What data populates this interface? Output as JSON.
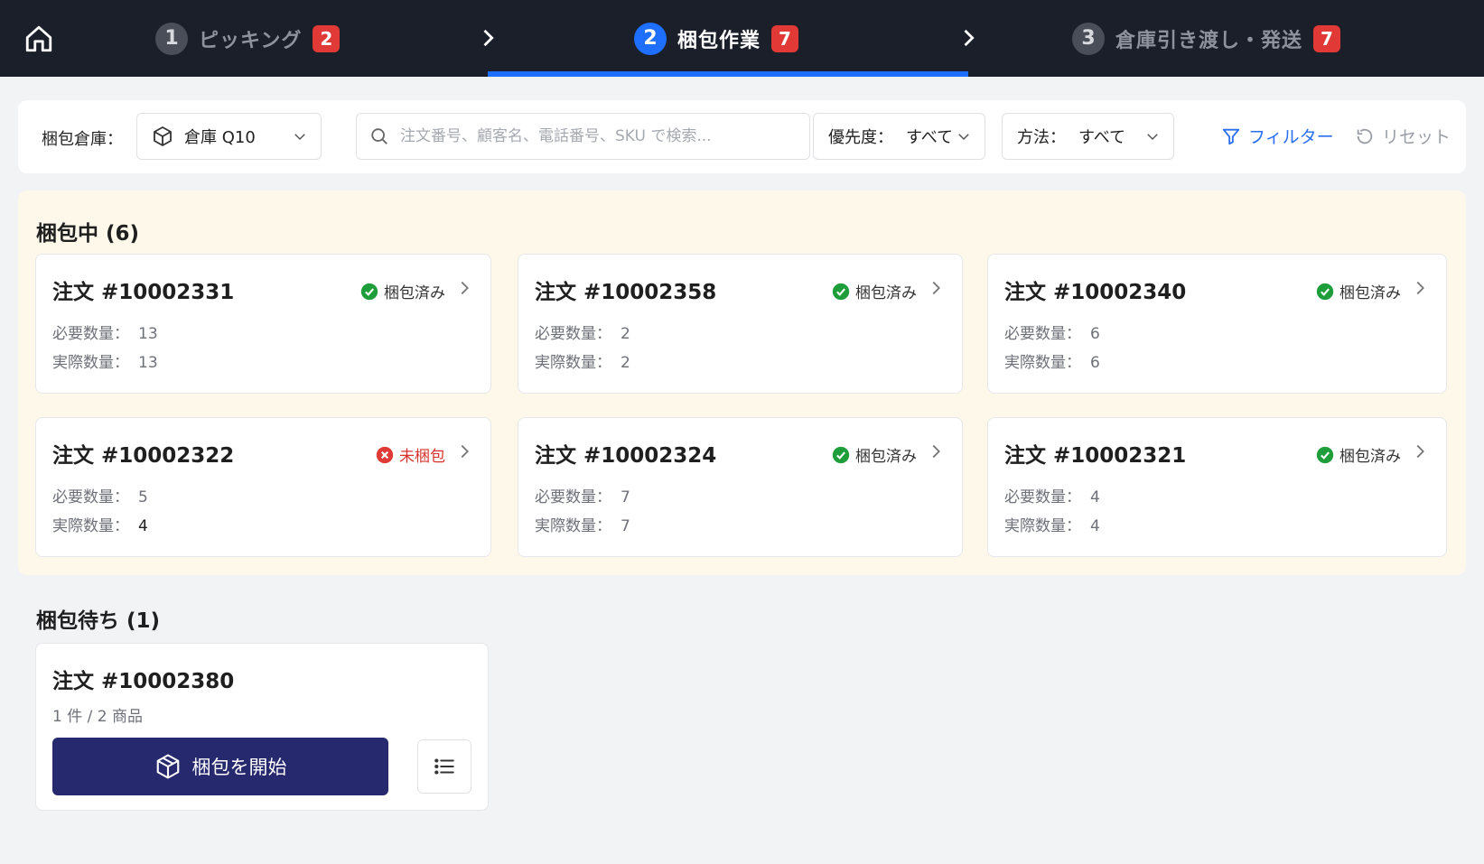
{
  "steps": [
    {
      "num": "1",
      "label": "ピッキング",
      "count": "2",
      "active": false
    },
    {
      "num": "2",
      "label": "梱包作業",
      "count": "7",
      "active": true
    },
    {
      "num": "3",
      "label": "倉庫引き渡し・発送",
      "count": "7",
      "active": false
    }
  ],
  "filters": {
    "warehouse_label": "梱包倉庫：",
    "warehouse_value": "倉庫 Q10",
    "search_placeholder": "注文番号、顧客名、電話番号、SKU で検索...",
    "priority_label": "優先度：",
    "priority_value": "すべて",
    "method_label": "方法：",
    "method_value": "すべて",
    "filter_label": "フィルター",
    "reset_label": "リセット"
  },
  "packing": {
    "title": "梱包中 (6)",
    "required_label": "必要数量：",
    "actual_label": "実際数量：",
    "cards": [
      {
        "order": "注文  #10002331",
        "status": "梱包済み",
        "ok": true,
        "required": "13",
        "actual": "13"
      },
      {
        "order": "注文  #10002358",
        "status": "梱包済み",
        "ok": true,
        "required": "2",
        "actual": "2"
      },
      {
        "order": "注文  #10002340",
        "status": "梱包済み",
        "ok": true,
        "required": "6",
        "actual": "6"
      },
      {
        "order": "注文  #10002322",
        "status": "未梱包",
        "ok": false,
        "required": "5",
        "actual": "4"
      },
      {
        "order": "注文  #10002324",
        "status": "梱包済み",
        "ok": true,
        "required": "7",
        "actual": "7"
      },
      {
        "order": "注文  #10002321",
        "status": "梱包済み",
        "ok": true,
        "required": "4",
        "actual": "4"
      }
    ]
  },
  "waiting": {
    "title": "梱包待ち (1)",
    "card": {
      "order": "注文  #10002380",
      "meta": "1 件 / 2 商品",
      "start_label": "梱包を開始"
    }
  },
  "colors": {
    "accent": "#1f6fff",
    "topbar": "#1b1f2a",
    "ok": "#1e9e3a",
    "bad": "#e13a36",
    "primary_button": "#27296e"
  },
  "icons": [
    "home-icon",
    "chevron-right-icon",
    "cube-icon",
    "search-icon",
    "chevron-down-icon",
    "filter-icon",
    "reset-icon",
    "check-circle-icon",
    "x-circle-icon",
    "list-icon"
  ]
}
